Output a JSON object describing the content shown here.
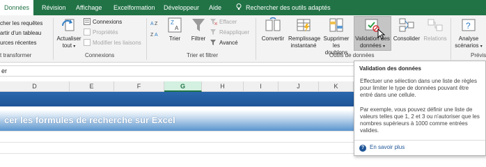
{
  "tabs": [
    {
      "label": "Données",
      "active": true
    },
    {
      "label": "Révision"
    },
    {
      "label": "Affichage"
    },
    {
      "label": "Excelformation"
    },
    {
      "label": "Développeur"
    },
    {
      "label": "Aide"
    }
  ],
  "tell_me": "Rechercher des outils adaptés",
  "left_group": {
    "items": [
      "cher les requêtes",
      "artir d'un tableau",
      "urces récentes"
    ],
    "label": "t transformer"
  },
  "connexions": {
    "refresh_label": "Actualiser tout",
    "items": [
      "Connexions",
      "Propriétés",
      "Modifier les liaisons"
    ],
    "label": "Connexions"
  },
  "sort_filter": {
    "sort_label": "Trier",
    "filter_label": "Filtrer",
    "items": [
      "Effacer",
      "Réappliquer",
      "Avancé"
    ],
    "label": "Trier et filtrer"
  },
  "data_tools": {
    "buttons": [
      {
        "label": "Convertir"
      },
      {
        "label": "Remplissage instantané"
      },
      {
        "label": "Supprimer les doublons"
      },
      {
        "label": "Validation des données"
      },
      {
        "label": "Consolider"
      },
      {
        "label": "Relations"
      }
    ],
    "label": "Outils de données"
  },
  "forecast": {
    "label1": "Analyse",
    "label2": "scénarios",
    "group_label": "Prévis"
  },
  "formula_bar": "er",
  "columns": [
    "D",
    "E",
    "F",
    "G",
    "H",
    "I",
    "J",
    "K"
  ],
  "selected_column": "G",
  "sheet_title": "cer les formules de recherche sur Excel",
  "tooltip": {
    "title": "Validation des données",
    "para1": "Effectuer une sélection dans une liste de règles pour limiter le type de données pouvant être entré dans une cellule.",
    "para2": "Par exemple, vous pouvez définir une liste de valeurs telles que 1, 2 et 3 ou n'autoriser que les nombres supérieurs à 1000 comme entrées valides.",
    "help": "En savoir plus"
  },
  "colors": {
    "accent": "#217346",
    "title_bar": "#1f5597",
    "link": "#1f5597"
  }
}
